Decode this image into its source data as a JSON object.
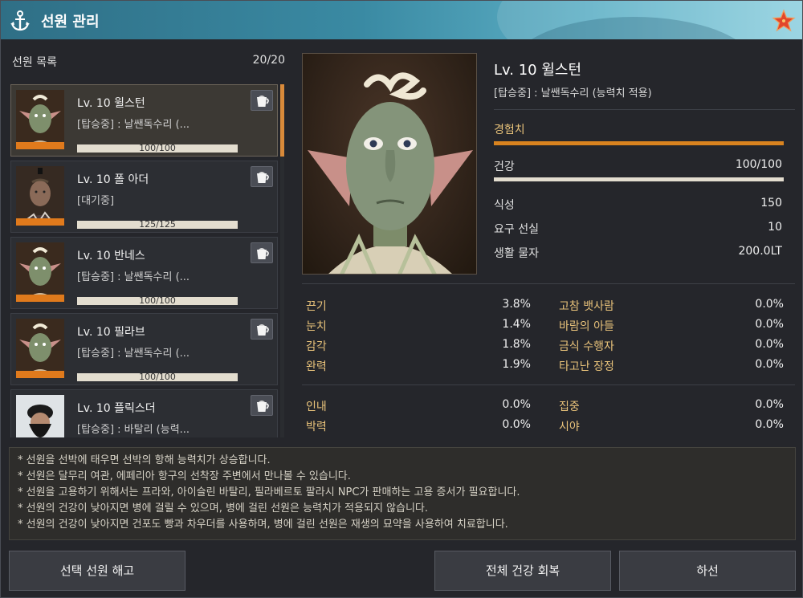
{
  "window": {
    "title": "선원 관리",
    "icons": {
      "anchor": "anchor-icon",
      "star": "starfish-icon"
    }
  },
  "crew_list": {
    "header": "선원 목록",
    "count": "20/20",
    "items": [
      {
        "name": "Lv. 10 윌스턴",
        "status": "[탑승중] : 날쌘독수리 (...",
        "hp": "100/100",
        "selected": true,
        "portrait": "goblin-portrait"
      },
      {
        "name": "Lv. 10 폴 아더",
        "status": "[대기중]",
        "hp": "125/125",
        "selected": false,
        "portrait": "sailor-portrait"
      },
      {
        "name": "Lv. 10 반네스",
        "status": "[탑승중] : 날쌘독수리 (...",
        "hp": "100/100",
        "selected": false,
        "portrait": "goblin-portrait"
      },
      {
        "name": "Lv. 10 필라브",
        "status": "[탑승중] : 날쌘독수리 (...",
        "hp": "100/100",
        "selected": false,
        "portrait": "goblin-portrait"
      },
      {
        "name": "Lv. 10 플릭스더",
        "status": "[탑승중] : 바탈리 (능력...",
        "hp": "",
        "selected": false,
        "portrait": "bearded-portrait"
      }
    ],
    "item_button_icon": "cup-icon"
  },
  "detail": {
    "name": "Lv. 10 윌스턴",
    "status": "[탑승중] : 날쌘독수리 (능력치 적용)",
    "exp_label": "경험치",
    "exp_fraction": 1.0,
    "health_label": "건강",
    "health_value": "100/100",
    "health_fraction": 1.0,
    "appetite_label": "식성",
    "appetite_value": "150",
    "required_bounty_label": "요구 선실",
    "required_bounty_value": "10",
    "living_cost_label": "생활 물자",
    "living_cost_value": "200.0LT"
  },
  "stats": {
    "group1": [
      {
        "label": "끈기",
        "value": "3.8%",
        "label2": "고참 뱃사람",
        "value2": "0.0%"
      },
      {
        "label": "눈치",
        "value": "1.4%",
        "label2": "바람의 아들",
        "value2": "0.0%"
      },
      {
        "label": "감각",
        "value": "1.8%",
        "label2": "금식 수행자",
        "value2": "0.0%"
      },
      {
        "label": "완력",
        "value": "1.9%",
        "label2": "타고난 장정",
        "value2": "0.0%"
      }
    ],
    "group2": [
      {
        "label": "인내",
        "value": "0.0%",
        "label2": "집중",
        "value2": "0.0%"
      },
      {
        "label": "박력",
        "value": "0.0%",
        "label2": "시야",
        "value2": "0.0%"
      }
    ]
  },
  "notes": [
    "* 선원을 선박에 태우면 선박의 항해 능력치가 상승합니다.",
    "* 선원은 달무리 여관, 에페리아 항구의 선착장 주변에서 만나볼 수 있습니다.",
    "* 선원을 고용하기 위해서는 프라와, 아이슬린 바탈리, 필라베르토 팔라시 NPC가 판매하는 고용 증서가 필요합니다.",
    "* 선원의 건강이 낮아지면 병에 걸릴 수 있으며, 병에 걸린 선원은 능력치가 적용되지 않습니다.",
    "* 선원의 건강이 낮아지면 건포도 빵과 차우더를 사용하며, 병에 걸린 선원은 재생의 묘약을 사용하여 치료합니다."
  ],
  "buttons": {
    "dismiss": "선택 선원 해고",
    "heal_all": "전체 건강 회복",
    "disembark": "하선"
  },
  "colors": {
    "accent_orange": "#e07a1c",
    "label_gold": "#e8c27a",
    "title_bar": "#3a8aa3"
  }
}
